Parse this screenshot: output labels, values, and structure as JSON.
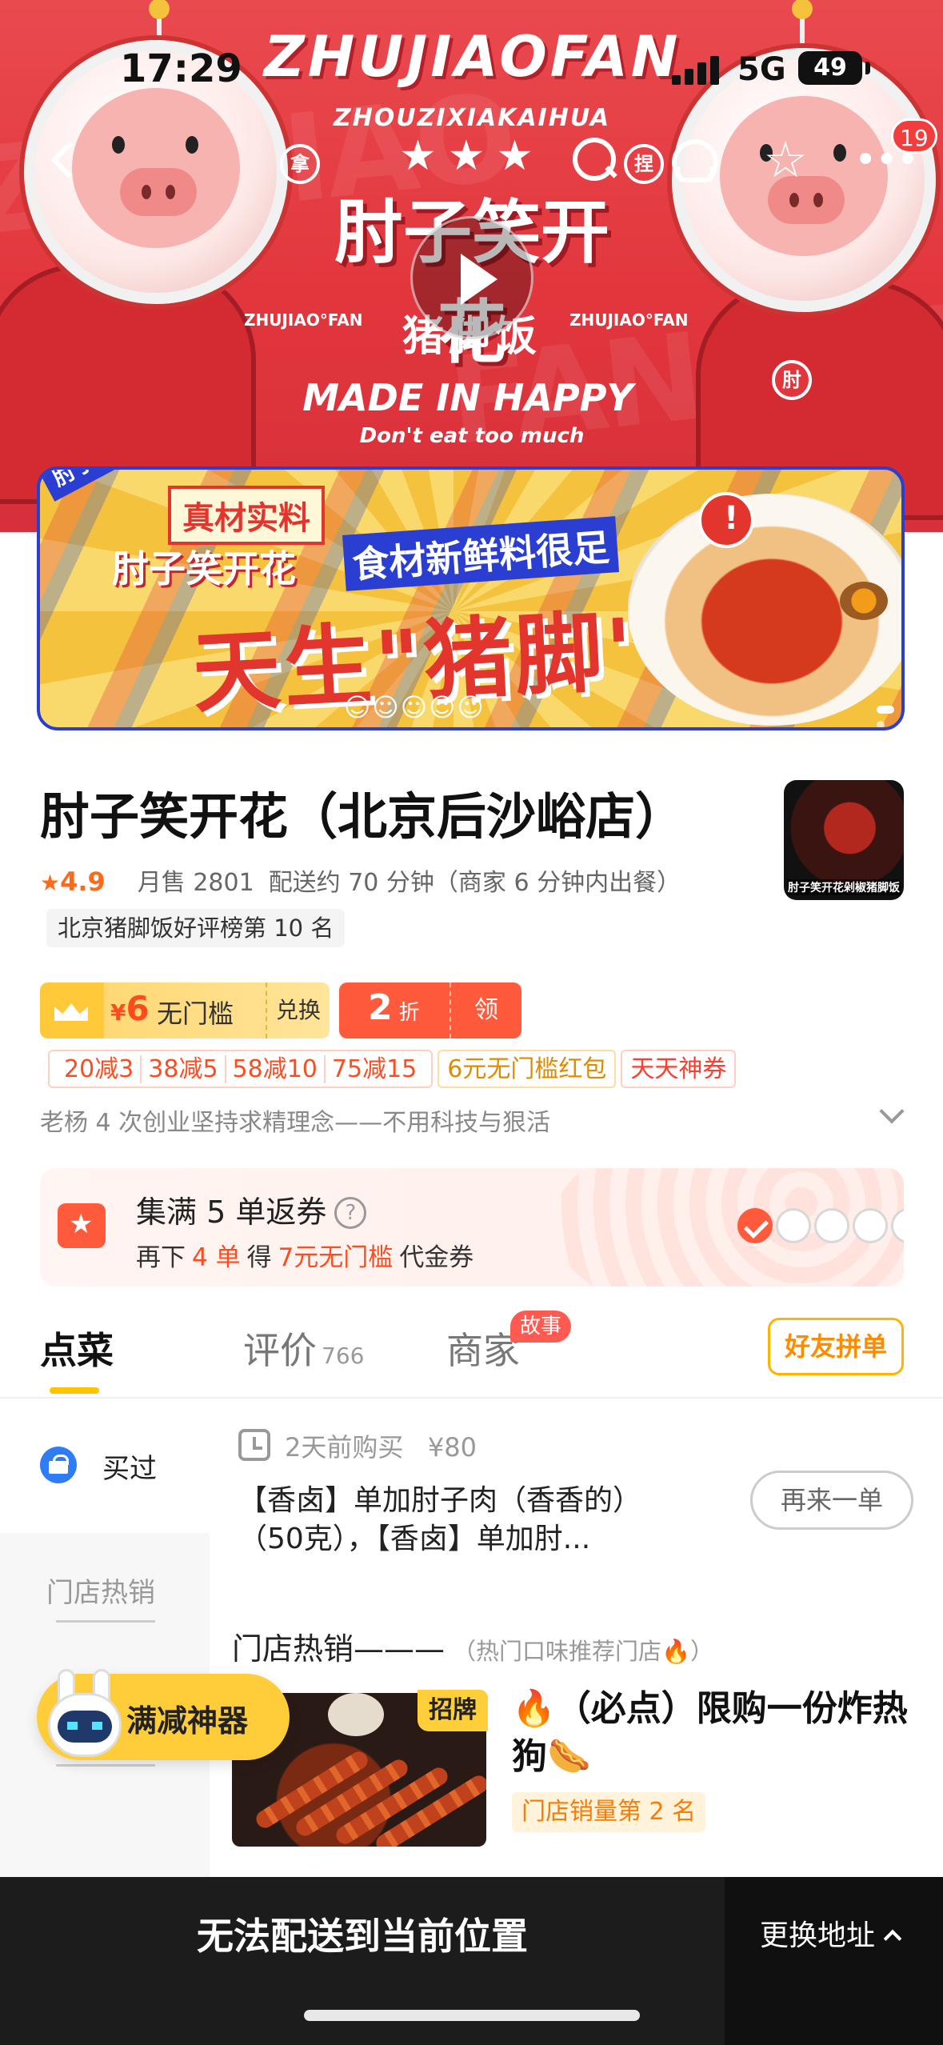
{
  "status_bar": {
    "time": "17:29",
    "network": "5G",
    "battery": "49"
  },
  "nav": {
    "message_badge": "19"
  },
  "hero": {
    "brand_arc": "ZHUJIAOFAN",
    "brand_sub": "ZHOUZIXIAKAIHUA",
    "left_ring": "拿",
    "right_ring": "捏",
    "brand_cn": "肘子笑开花",
    "brand_cn_sub": "猪脚饭",
    "brand_small_left": "ZHUJIAO°FAN",
    "brand_small_right": "ZHUJIAO°FAN",
    "made": "MADE IN HAPPY",
    "dont": "Don't eat too much",
    "suit_char": "肘"
  },
  "promo": {
    "corner": "肘子笑开",
    "tag": "真材实料",
    "brand": "肘子笑开花",
    "line1": "食材新鲜料很足",
    "big": "天生\"猪脚\"",
    "smiles": "☺☺☺☺☺"
  },
  "store": {
    "name": "肘子笑开花（北京后沙峪店）",
    "logo_text": "肘子笑开花剁椒猪脚饭",
    "star": "★",
    "rating": "4.9",
    "monthly_sales": "月售 2801",
    "delivery": "配送约 70 分钟（商家 6 分钟内出餐）",
    "rank_tag": "北京猪脚饭好评榜第 10 名",
    "slogan": "老杨 4 次创业坚持求精理念——不用科技与狠活"
  },
  "coupons": {
    "vip_currency": "¥",
    "vip_amount": "6",
    "vip_label": "无门槛",
    "vip_exchange": "兑换",
    "discount_num": "2",
    "discount_unit": "折",
    "discount_get": "领",
    "full_reductions": [
      "20减3",
      "38减5",
      "58减10",
      "75减15"
    ],
    "red_packet": "6元无门槛红包",
    "daily_coupon": "天天神券"
  },
  "collect": {
    "title": "集满 5 单返券",
    "help": "?",
    "sub_prefix": "再下",
    "sub_count": "4 单",
    "sub_mid": "得",
    "sub_reward": "7元无门槛",
    "sub_suffix": "代金券",
    "progress_done": 1,
    "progress_total": 5
  },
  "tabs": {
    "order": "点菜",
    "review": "评价",
    "review_count": "766",
    "shop": "商家",
    "shop_badge": "故事",
    "group": "好友拼单"
  },
  "categories": {
    "bought": "买过",
    "hot": "门店热销"
  },
  "previous_order": {
    "time": "2天前购买",
    "price": "¥80",
    "items": "【香卤】单加肘子肉（香香的）（50克），【香卤】单加肘...",
    "reorder": "再来一单"
  },
  "section": {
    "title": "门店热销———",
    "subtitle": "（热门口味推荐门店🔥）"
  },
  "featured_item": {
    "badge": "招牌",
    "name": "🔥（必点）限购一份炸热狗🌭",
    "rank": "门店销量第 2 名"
  },
  "floating": {
    "label": "满减神器"
  },
  "bottom_bar": {
    "message": "无法配送到当前位置",
    "change_address": "更换地址"
  },
  "colors": {
    "brand_red": "#e2363d",
    "accent_yellow": "#ffc300",
    "price_orange": "#ff4b1f",
    "bottom_bar": "#1c1c1c"
  }
}
